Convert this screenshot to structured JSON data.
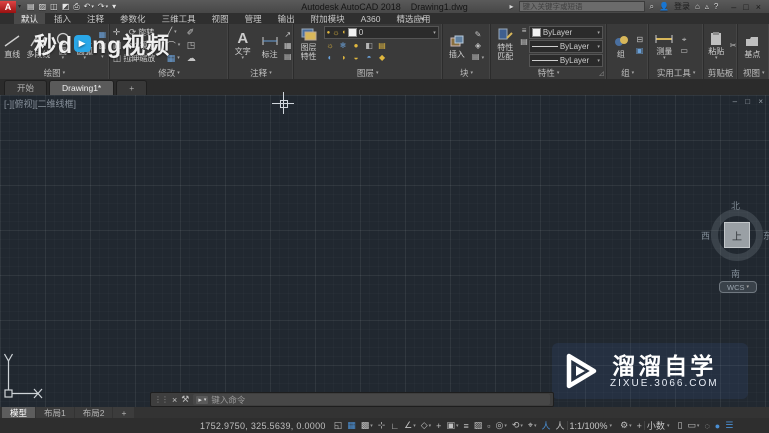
{
  "titlebar": {
    "app_initial": "A",
    "title": "Autodesk AutoCAD 2018",
    "doc": "Drawing1.dwg",
    "search_placeholder": "键入关键字或短语",
    "signin": "登录",
    "window": {
      "min": "–",
      "max": "□",
      "close": "×"
    }
  },
  "qat": [
    {
      "name": "new-file-icon",
      "glyph": "▤"
    },
    {
      "name": "open-file-icon",
      "glyph": "▨"
    },
    {
      "name": "save-icon",
      "glyph": "◫"
    },
    {
      "name": "save-as-icon",
      "glyph": "◩"
    },
    {
      "name": "plot-icon",
      "glyph": "⎙"
    },
    {
      "name": "undo-icon",
      "glyph": "↶",
      "dd": true
    },
    {
      "name": "redo-icon",
      "glyph": "↷",
      "dd": true
    },
    {
      "name": "qat-customize-icon",
      "glyph": "▾"
    }
  ],
  "menubar": [
    {
      "label": "默认",
      "active": true
    },
    {
      "label": "插入"
    },
    {
      "label": "注释"
    },
    {
      "label": "参数化"
    },
    {
      "label": "三维工具"
    },
    {
      "label": "视图"
    },
    {
      "label": "管理"
    },
    {
      "label": "输出"
    },
    {
      "label": "附加模块"
    },
    {
      "label": "A360"
    },
    {
      "label": "精选应用"
    }
  ],
  "ribbon": {
    "draw": {
      "label": "绘图",
      "line": "直线",
      "polyline": "多段线",
      "circle": "圆",
      "arc": "圆弧"
    },
    "modify": {
      "label": "修改",
      "rotate": "旋转",
      "mirror": "镜像",
      "stretch": "拉伸",
      "scale": "缩放"
    },
    "annotate": {
      "label": "注释",
      "text": "文字",
      "dim": "标注"
    },
    "layers": {
      "label": "图层",
      "big1": "图层",
      "big2": "特性",
      "current": "0"
    },
    "block": {
      "label": "块",
      "insert": "插入"
    },
    "props": {
      "label": "特性",
      "big1": "特性",
      "big2": "匹配",
      "d1": "ByLayer",
      "d2": "ByLayer",
      "d3": "ByLayer"
    },
    "groups": {
      "label": "组",
      "group": "组"
    },
    "utils": {
      "label": "实用工具",
      "measure": "测量"
    },
    "clip": {
      "label": "剪贴板",
      "paste": "粘贴"
    },
    "view": {
      "label": "视图",
      "base": "基点"
    }
  },
  "filetabs": [
    {
      "label": "开始"
    },
    {
      "label": "Drawing1*",
      "active": true
    },
    {
      "label": "+"
    }
  ],
  "canvas": {
    "viewport_label": "[-][俯视][二维线框]",
    "win_controls": "– □ ×",
    "viewcube": {
      "n": "北",
      "s": "南",
      "w": "西",
      "e": "东",
      "top": "上",
      "wcs": "WCS"
    }
  },
  "watermarks": {
    "top": {
      "pre": "秒d",
      "post": "ng视频",
      "play": "▶"
    },
    "bottom": {
      "title": "溜溜自学",
      "url": "ZIXUE.3066.COM"
    }
  },
  "command": {
    "placeholder": "键入命令",
    "prompt": "▸",
    "close": "×",
    "wrench": "⚒",
    "grip": "⋮⋮"
  },
  "layouttabs": [
    {
      "label": "模型",
      "active": true
    },
    {
      "label": "布局1"
    },
    {
      "label": "布局2"
    },
    {
      "label": "+"
    }
  ],
  "statusbar": {
    "coords": "1752.9750, 325.5639, 0.0000",
    "scale": "1:1/100%",
    "units": "小数",
    "icons_a": [
      {
        "name": "model-space-icon",
        "glyph": "◱"
      },
      {
        "name": "grid-icon",
        "glyph": "▦",
        "accent": true
      },
      {
        "name": "snap-icon",
        "glyph": "▩",
        "dd": true
      },
      {
        "name": "dynamic-input-icon",
        "glyph": "⊹"
      },
      {
        "name": "ortho-icon",
        "glyph": "∟"
      },
      {
        "name": "polar-tracking-icon",
        "glyph": "∠",
        "dd": true
      },
      {
        "name": "isodraft-icon",
        "glyph": "◇",
        "dd": true
      },
      {
        "name": "osnap-tracking-icon",
        "glyph": "+"
      },
      {
        "name": "osnap-icon",
        "glyph": "▣",
        "dd": true
      },
      {
        "name": "lineweight-icon",
        "glyph": "≡"
      },
      {
        "name": "transparency-icon",
        "glyph": "▨"
      },
      {
        "name": "selection-cycling-icon",
        "glyph": "▫"
      },
      {
        "name": "osnap-3d-icon",
        "glyph": "◎",
        "dd": true
      },
      {
        "name": "dynamic-ucs-icon",
        "glyph": "⟲",
        "dd": true
      },
      {
        "name": "selection-filter-icon",
        "glyph": "⌖",
        "dd": true
      },
      {
        "name": "annotation-visibility-icon",
        "glyph": "人",
        "accent": true
      },
      {
        "name": "annotation-autoscale-icon",
        "glyph": "人"
      }
    ],
    "icons_b": [
      {
        "name": "workspace-gear-icon",
        "glyph": "⚙",
        "dd": true
      },
      {
        "name": "annotation-monitor-icon",
        "glyph": "+"
      }
    ],
    "icons_c": [
      {
        "name": "quick-properties-icon",
        "glyph": "▯"
      },
      {
        "name": "lock-ui-icon",
        "glyph": "▭",
        "dd": true
      },
      {
        "name": "isolate-objects-icon",
        "glyph": "◌"
      },
      {
        "name": "graphics-performance-icon",
        "glyph": "●",
        "accent": true
      },
      {
        "name": "customize-icon",
        "glyph": "☰",
        "accent": true
      }
    ]
  },
  "layer_combo": {
    "bulb": "●",
    "sun": "☼",
    "lock": "◖",
    "value_dd": "▾"
  },
  "layer_tools": [
    {
      "name": "layer-off-icon",
      "glyph": "☼",
      "c": "y"
    },
    {
      "name": "layer-freeze-icon",
      "glyph": "❄",
      "c": "b"
    },
    {
      "name": "layer-lock-icon",
      "glyph": "●",
      "c": "y"
    },
    {
      "name": "layer-plot-icon",
      "glyph": "◧",
      "c": "g"
    },
    {
      "name": "layer-state-icon",
      "glyph": "▤",
      "c": "y"
    },
    {
      "name": "layer-isolate-icon",
      "glyph": "◐",
      "c": "b"
    },
    {
      "name": "layer-unisolate-icon",
      "glyph": "◑",
      "c": "y"
    },
    {
      "name": "layer-previous-icon",
      "glyph": "◒",
      "c": "y"
    },
    {
      "name": "layer-match-icon",
      "glyph": "◓",
      "c": "b"
    },
    {
      "name": "layer-walk-icon",
      "glyph": "◆",
      "c": "y"
    }
  ],
  "colors": {
    "accent_blue": "#4a8fd4",
    "canvas_bg": "#212830",
    "layer_yellow": "#e0b73e"
  }
}
